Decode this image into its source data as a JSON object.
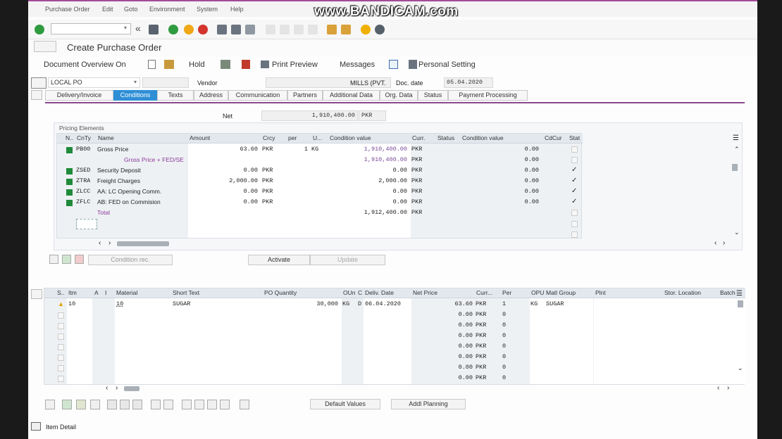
{
  "watermark": "www.BANDICAM.com",
  "menubar": {
    "items": [
      "Purchase Order",
      "Edit",
      "Goto",
      "Environment",
      "System",
      "Help"
    ]
  },
  "page_title": "Create Purchase Order",
  "app_toolbar": {
    "document_overview": "Document Overview On",
    "hold": "Hold",
    "print_preview": "Print Preview",
    "messages": "Messages",
    "personal_setting": "Personal Setting"
  },
  "header": {
    "doc_type": "LOCAL PO",
    "vendor_label": "Vendor",
    "vendor_value": "MILLS (PVT.",
    "doc_date_label": "Doc. date",
    "doc_date_value": "05.04.2020"
  },
  "tabs": [
    "Delivery/Invoice",
    "Conditions",
    "Texts",
    "Address",
    "Communication",
    "Partners",
    "Additional Data",
    "Org. Data",
    "Status",
    "Payment Processing"
  ],
  "active_tab": "Conditions",
  "net": {
    "label": "Net",
    "value": "1,910,400.00",
    "currency": "PKR"
  },
  "pricing": {
    "section_label": "Pricing Elements",
    "columns": [
      "N..",
      "CnTy",
      "Name",
      "Amount",
      "Crcy",
      "per",
      "U...",
      "Condition value",
      "Curr.",
      "Status",
      "Condition value",
      "CdCur",
      "Stat"
    ],
    "rows": [
      {
        "cnty": "PB00",
        "name": "Gross Price",
        "amount": "63.60",
        "crcy": "PKR",
        "per": "1",
        "uom": "KG",
        "cond_value": "1,910,400.00",
        "curr": "PKR",
        "cond_value2": "0.00",
        "stat": ""
      },
      {
        "cnty": "",
        "name": "Gross Price + FED/SE",
        "amount": "",
        "crcy": "",
        "per": "",
        "uom": "",
        "cond_value": "1,910,400.00",
        "curr": "PKR",
        "cond_value2": "0.00",
        "stat": ""
      },
      {
        "cnty": "ZSED",
        "name": "Security Deposit",
        "amount": "0.00",
        "crcy": "PKR",
        "per": "",
        "uom": "",
        "cond_value": "0.00",
        "curr": "PKR",
        "cond_value2": "0.00",
        "stat": "✓"
      },
      {
        "cnty": "ZTRA",
        "name": "Freight Charges",
        "amount": "2,000.00",
        "crcy": "PKR",
        "per": "",
        "uom": "",
        "cond_value": "2,000.00",
        "curr": "PKR",
        "cond_value2": "0.00",
        "stat": "✓"
      },
      {
        "cnty": "ZLCC",
        "name": "AA: LC Opening Comm.",
        "amount": "0.00",
        "crcy": "PKR",
        "per": "",
        "uom": "",
        "cond_value": "0.00",
        "curr": "PKR",
        "cond_value2": "0.00",
        "stat": "✓"
      },
      {
        "cnty": "ZFLC",
        "name": "AB: FED on Commision",
        "amount": "0.00",
        "crcy": "PKR",
        "per": "",
        "uom": "",
        "cond_value": "0.00",
        "curr": "PKR",
        "cond_value2": "0.00",
        "stat": "✓"
      },
      {
        "cnty": "",
        "name": "Total",
        "amount": "",
        "crcy": "",
        "per": "",
        "uom": "",
        "cond_value": "1,912,400.00",
        "curr": "PKR",
        "cond_value2": "",
        "stat": ""
      }
    ]
  },
  "pricing_buttons": {
    "condition_rec": "Condition rec.",
    "activate": "Activate",
    "update": "Update"
  },
  "items": {
    "columns": [
      "S..",
      "Itm",
      "A",
      "I",
      "Material",
      "Short Text",
      "PO Quantity",
      "OUn",
      "C",
      "Deliv. Date",
      "Net Price",
      "Curr...",
      "Per",
      "OPU",
      "Matl Group",
      "Plnt",
      "Stor. Location",
      "Batch"
    ],
    "rows": [
      {
        "itm": "10",
        "material": "10",
        "short_text": "SUGAR",
        "qty": "30,000",
        "oun": "KG",
        "c": "D",
        "deliv": "06.04.2020",
        "net_price": "63.60",
        "curr": "PKR",
        "per": "1",
        "opu": "KG",
        "matl_group": "SUGAR"
      },
      {
        "itm": "",
        "material": "",
        "short_text": "",
        "qty": "",
        "oun": "",
        "c": "",
        "deliv": "",
        "net_price": "0.00",
        "curr": "PKR",
        "per": "0",
        "opu": "",
        "matl_group": ""
      },
      {
        "itm": "",
        "material": "",
        "short_text": "",
        "qty": "",
        "oun": "",
        "c": "",
        "deliv": "",
        "net_price": "0.00",
        "curr": "PKR",
        "per": "0",
        "opu": "",
        "matl_group": ""
      },
      {
        "itm": "",
        "material": "",
        "short_text": "",
        "qty": "",
        "oun": "",
        "c": "",
        "deliv": "",
        "net_price": "0.00",
        "curr": "PKR",
        "per": "0",
        "opu": "",
        "matl_group": ""
      },
      {
        "itm": "",
        "material": "",
        "short_text": "",
        "qty": "",
        "oun": "",
        "c": "",
        "deliv": "",
        "net_price": "0.00",
        "curr": "PKR",
        "per": "0",
        "opu": "",
        "matl_group": ""
      },
      {
        "itm": "",
        "material": "",
        "short_text": "",
        "qty": "",
        "oun": "",
        "c": "",
        "deliv": "",
        "net_price": "0.00",
        "curr": "PKR",
        "per": "0",
        "opu": "",
        "matl_group": ""
      },
      {
        "itm": "",
        "material": "",
        "short_text": "",
        "qty": "",
        "oun": "",
        "c": "",
        "deliv": "",
        "net_price": "0.00",
        "curr": "PKR",
        "per": "0",
        "opu": "",
        "matl_group": ""
      },
      {
        "itm": "",
        "material": "",
        "short_text": "",
        "qty": "",
        "oun": "",
        "c": "",
        "deliv": "",
        "net_price": "0.00",
        "curr": "PKR",
        "per": "0",
        "opu": "",
        "matl_group": ""
      }
    ]
  },
  "item_buttons": {
    "default_values": "Default Values",
    "addl_planning": "Addl Planning"
  },
  "item_detail": "Item Detail",
  "colors": {
    "accent_tab": "#2f8fd6",
    "tab_line": "#8a4a8c",
    "status_green": "#1f8a3a"
  }
}
